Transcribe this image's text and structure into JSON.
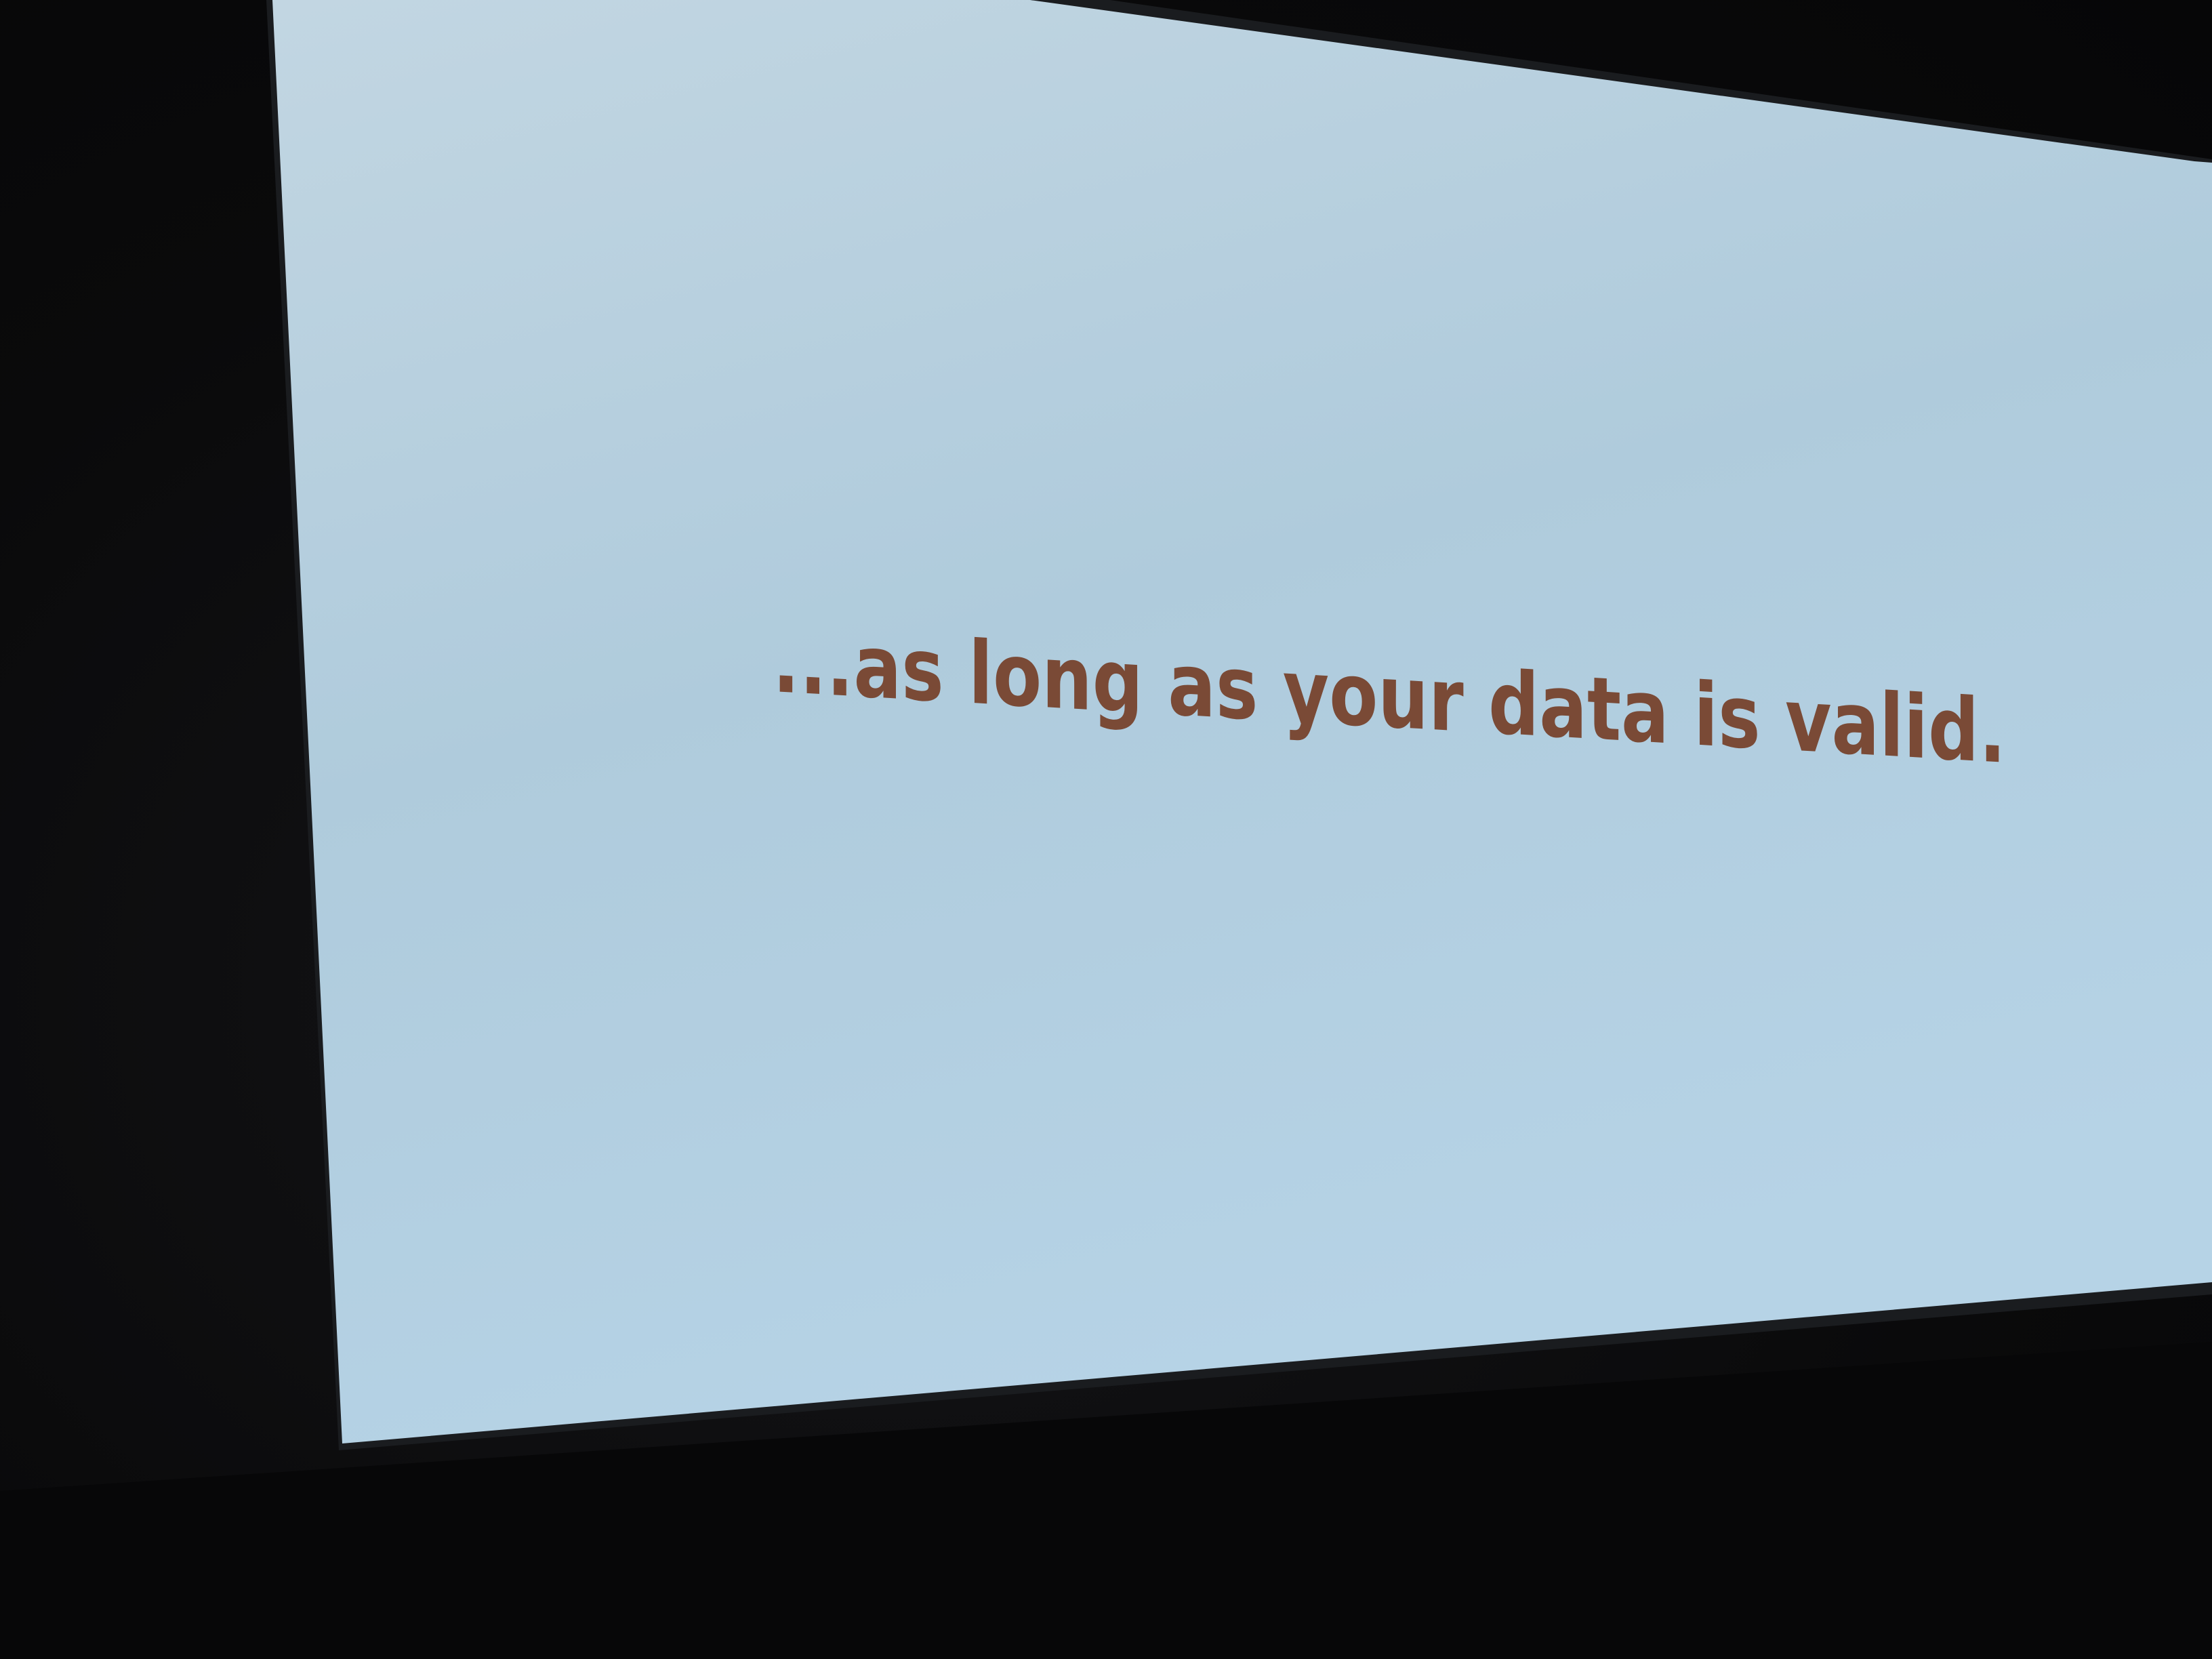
{
  "slide": {
    "text": "...as long as your data is valid.",
    "text_color": "#7a4a36",
    "background_color": "#b4d2e4"
  },
  "room": {
    "background_color": "#0b0b0c"
  }
}
